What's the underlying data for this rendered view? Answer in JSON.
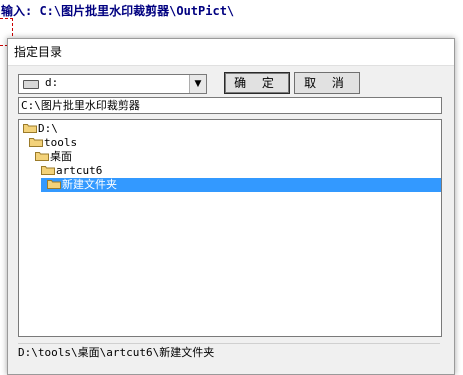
{
  "background": {
    "input_label": "输入: C:\\图片批里水印裁剪器\\OutPict\\"
  },
  "dialog": {
    "title": "指定目录",
    "drive": {
      "selected": "d:"
    },
    "ok_label": "确 定",
    "cancel_label": "取 消",
    "path_value": "C:\\图片批里水印裁剪器",
    "tree": [
      {
        "label": "D:\\",
        "level": 0,
        "selected": false
      },
      {
        "label": "tools",
        "level": 1,
        "selected": false
      },
      {
        "label": "桌面",
        "level": 2,
        "selected": false
      },
      {
        "label": "artcut6",
        "level": 3,
        "selected": false
      },
      {
        "label": "新建文件夹",
        "level": 4,
        "selected": true
      }
    ],
    "status_path": "D:\\tools\\桌面\\artcut6\\新建文件夹"
  },
  "colors": {
    "selection": "#3399ff",
    "folder": "#f3d27a",
    "label_text": "#000080"
  },
  "icons": {
    "drive": "hard-drive-icon",
    "folder": "folder-icon",
    "dropdown": "chevron-down-icon"
  }
}
